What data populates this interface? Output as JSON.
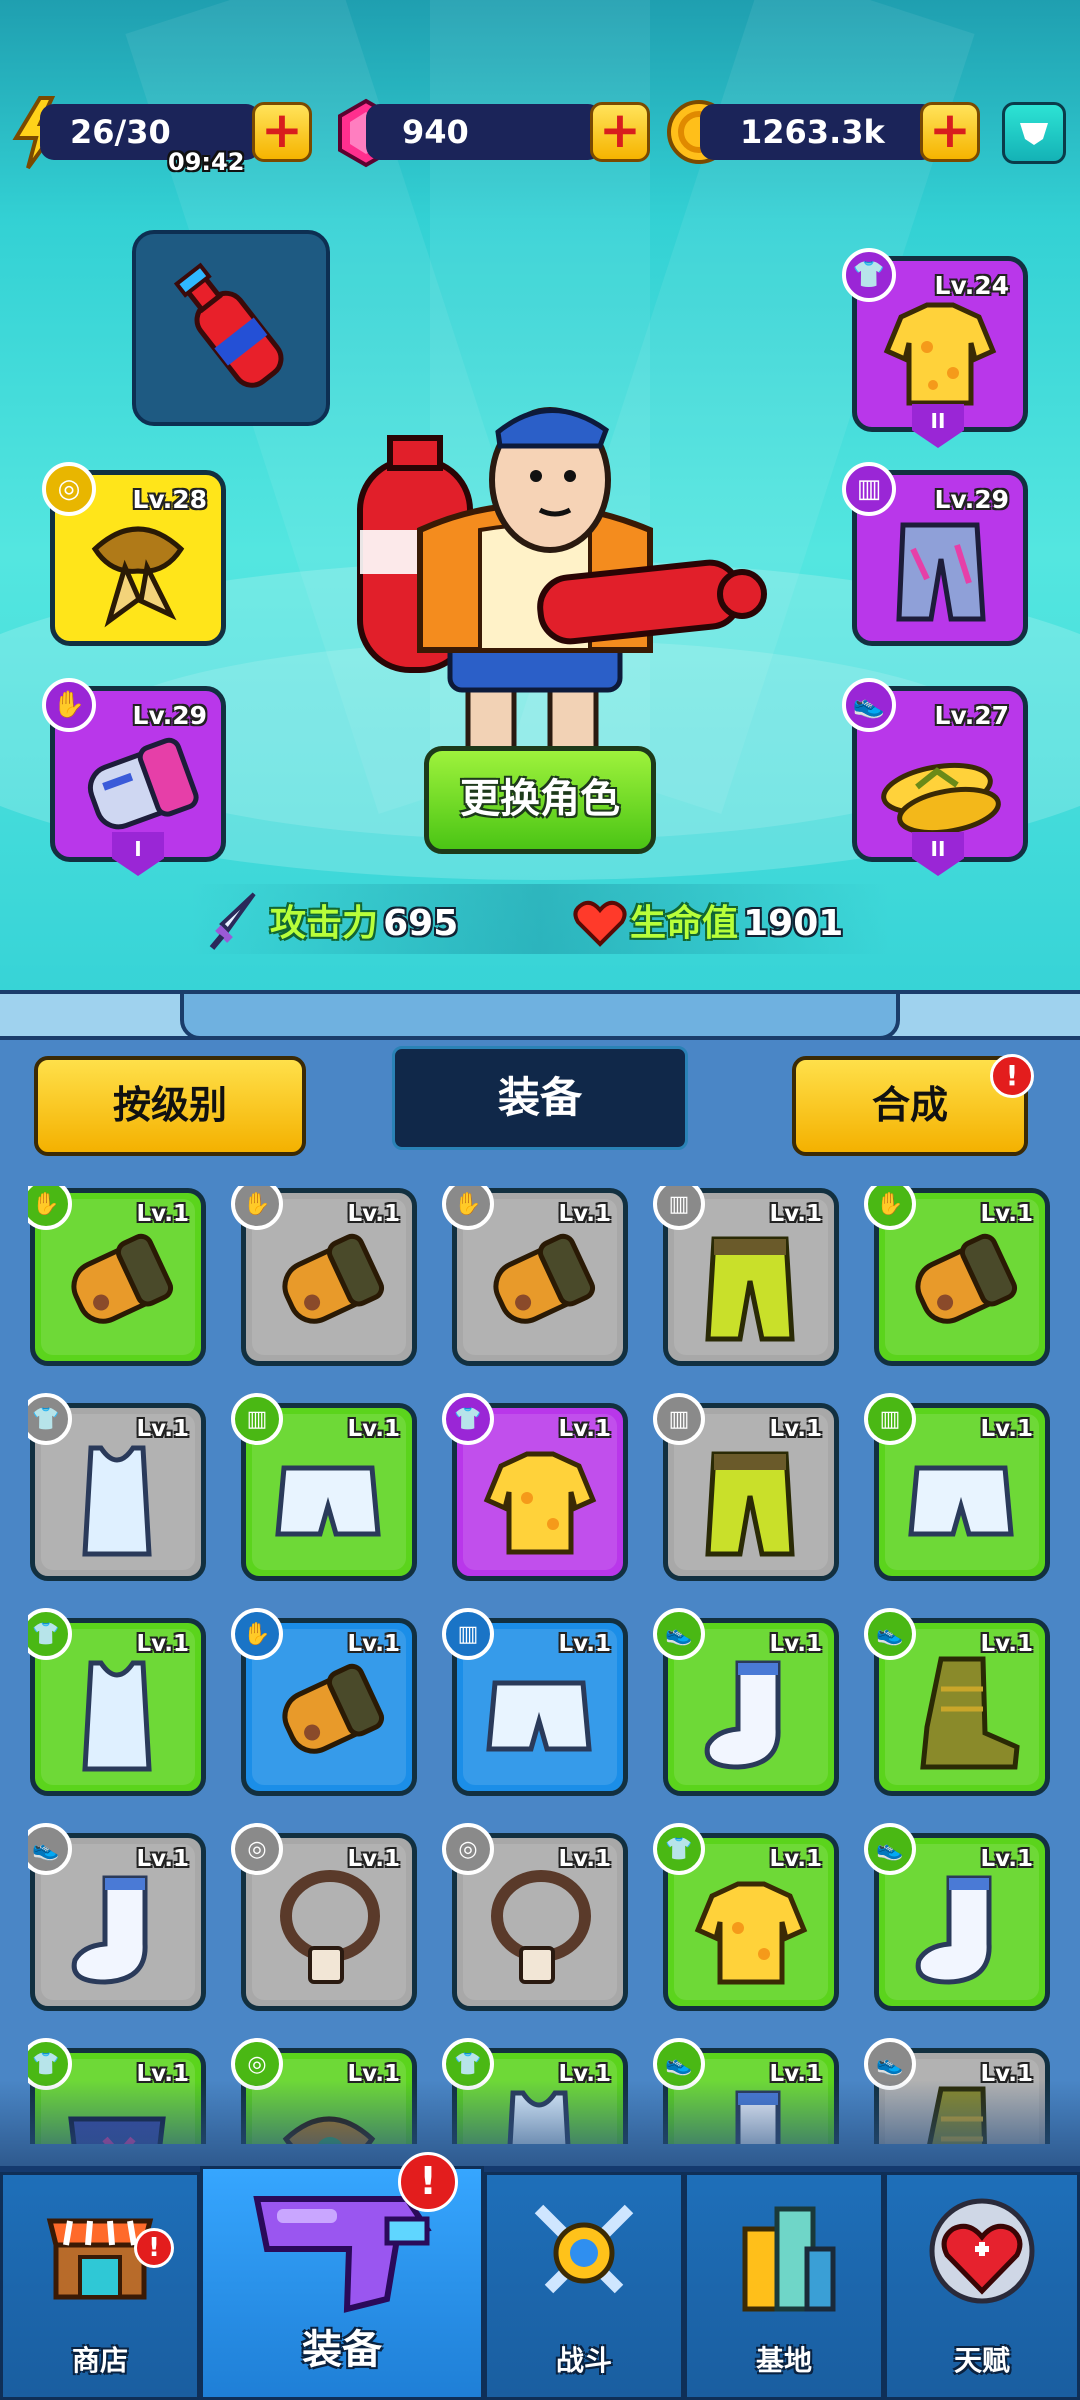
{
  "resources": {
    "energy": "26/30",
    "energy_timer": "09:42",
    "gems": "940",
    "coins": "1263.3k",
    "plus": "+"
  },
  "hero": {
    "left_slots": [
      {
        "level": "Lv.28",
        "item": "scarf-icon",
        "rarity": "gold"
      },
      {
        "level": "Lv.29",
        "item": "glove-icon",
        "rarity": "purple",
        "tier": "I"
      }
    ],
    "right_slots": [
      {
        "level": "Lv.24",
        "item": "shirt-icon",
        "rarity": "purple",
        "tier": "II"
      },
      {
        "level": "Lv.29",
        "item": "pants-icon",
        "rarity": "purple"
      },
      {
        "level": "Lv.27",
        "item": "flip-flop-icon",
        "rarity": "purple",
        "tier": "II"
      }
    ],
    "change_character": "更换角色",
    "attack_label": "攻击力",
    "attack_value": "695",
    "hp_label": "生命值",
    "hp_value": "1901"
  },
  "inventory": {
    "sort_button": "按级别",
    "title": "装备",
    "merge_button": "合成",
    "alert": "!",
    "items": [
      {
        "level": "Lv.1",
        "rarity": "green",
        "icon": "glove-icon"
      },
      {
        "level": "Lv.1",
        "rarity": "grey",
        "icon": "glove-icon"
      },
      {
        "level": "Lv.1",
        "rarity": "grey",
        "icon": "glove-icon"
      },
      {
        "level": "Lv.1",
        "rarity": "grey",
        "icon": "pants-icon"
      },
      {
        "level": "Lv.1",
        "rarity": "green",
        "icon": "glove-icon"
      },
      {
        "level": "Lv.1",
        "rarity": "grey",
        "icon": "tank-top-icon"
      },
      {
        "level": "Lv.1",
        "rarity": "green",
        "icon": "shorts-icon"
      },
      {
        "level": "Lv.1",
        "rarity": "purple",
        "icon": "shirt-icon"
      },
      {
        "level": "Lv.1",
        "rarity": "grey",
        "icon": "pants-icon"
      },
      {
        "level": "Lv.1",
        "rarity": "green",
        "icon": "shorts-icon"
      },
      {
        "level": "Lv.1",
        "rarity": "green",
        "icon": "tank-top-icon"
      },
      {
        "level": "Lv.1",
        "rarity": "blue",
        "icon": "glove-icon"
      },
      {
        "level": "Lv.1",
        "rarity": "blue",
        "icon": "shorts-icon"
      },
      {
        "level": "Lv.1",
        "rarity": "green",
        "icon": "sock-icon"
      },
      {
        "level": "Lv.1",
        "rarity": "green",
        "icon": "boot-icon"
      },
      {
        "level": "Lv.1",
        "rarity": "grey",
        "icon": "sock-icon"
      },
      {
        "level": "Lv.1",
        "rarity": "grey",
        "icon": "necklace-icon"
      },
      {
        "level": "Lv.1",
        "rarity": "grey",
        "icon": "necklace-icon"
      },
      {
        "level": "Lv.1",
        "rarity": "green",
        "icon": "shirt-icon"
      },
      {
        "level": "Lv.1",
        "rarity": "green",
        "icon": "sock-icon"
      },
      {
        "level": "Lv.1",
        "rarity": "green",
        "icon": "armor-icon"
      },
      {
        "level": "Lv.1",
        "rarity": "green",
        "icon": "scarf-icon"
      },
      {
        "level": "Lv.1",
        "rarity": "green",
        "icon": "tank-top-icon"
      },
      {
        "level": "Lv.1",
        "rarity": "green",
        "icon": "sock-icon"
      },
      {
        "level": "Lv.1",
        "rarity": "grey",
        "icon": "boot-icon"
      }
    ]
  },
  "nav": {
    "shop": "商店",
    "equipment": "装备",
    "battle": "战斗",
    "base": "基地",
    "talent": "天赋"
  },
  "colors": {
    "green": "#5bd41c",
    "grey": "#a8a8a8",
    "purple": "#b937ea",
    "blue": "#1b8ee8",
    "gold": "#ffe51a"
  }
}
